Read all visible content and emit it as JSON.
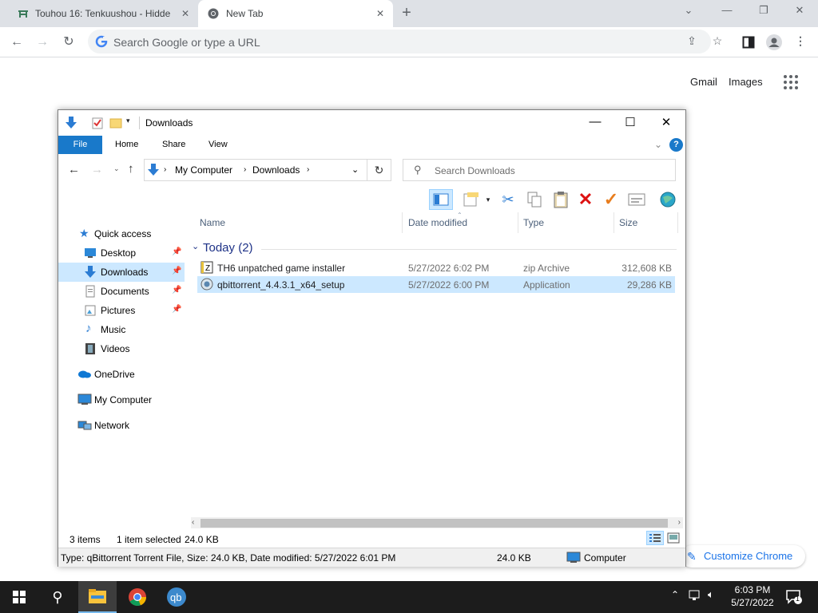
{
  "browser": {
    "tabs": [
      {
        "title": "Touhou 16: Tenkuushou - Hidde"
      },
      {
        "title": "New Tab"
      }
    ],
    "omnibox_placeholder": "Search Google or type a URL",
    "ntp": {
      "gmail": "Gmail",
      "images": "Images",
      "customize": "Customize Chrome"
    }
  },
  "explorer": {
    "title": "Downloads",
    "ribbon_tabs": [
      "File",
      "Home",
      "Share",
      "View"
    ],
    "breadcrumb": [
      "My Computer",
      "Downloads"
    ],
    "search_placeholder": "Search Downloads",
    "nav": [
      {
        "label": "Quick access"
      },
      {
        "label": "Desktop"
      },
      {
        "label": "Downloads"
      },
      {
        "label": "Documents"
      },
      {
        "label": "Pictures"
      },
      {
        "label": "Music"
      },
      {
        "label": "Videos"
      },
      {
        "label": "OneDrive"
      },
      {
        "label": "My Computer"
      },
      {
        "label": "Network"
      }
    ],
    "columns": [
      "Name",
      "Date modified",
      "Type",
      "Size"
    ],
    "group": "Today (2)",
    "files": [
      {
        "name": "TH6 unpatched game installer",
        "date": "5/27/2022 6:02 PM",
        "type": "zip Archive",
        "size": "312,608 KB"
      },
      {
        "name": "qbittorrent_4.4.3.1_x64_setup",
        "date": "5/27/2022 6:00 PM",
        "type": "Application",
        "size": "29,286 KB"
      }
    ],
    "status": {
      "items": "3 items",
      "selected": "1 item selected",
      "size": "24.0 KB"
    },
    "details": {
      "text": "Type: qBittorrent Torrent File, Size: 24.0 KB, Date modified: 5/27/2022 6:01 PM",
      "size": "24.0 KB",
      "location": "Computer"
    }
  },
  "taskbar": {
    "time": "6:03 PM",
    "date": "5/27/2022",
    "notifications": "1"
  }
}
